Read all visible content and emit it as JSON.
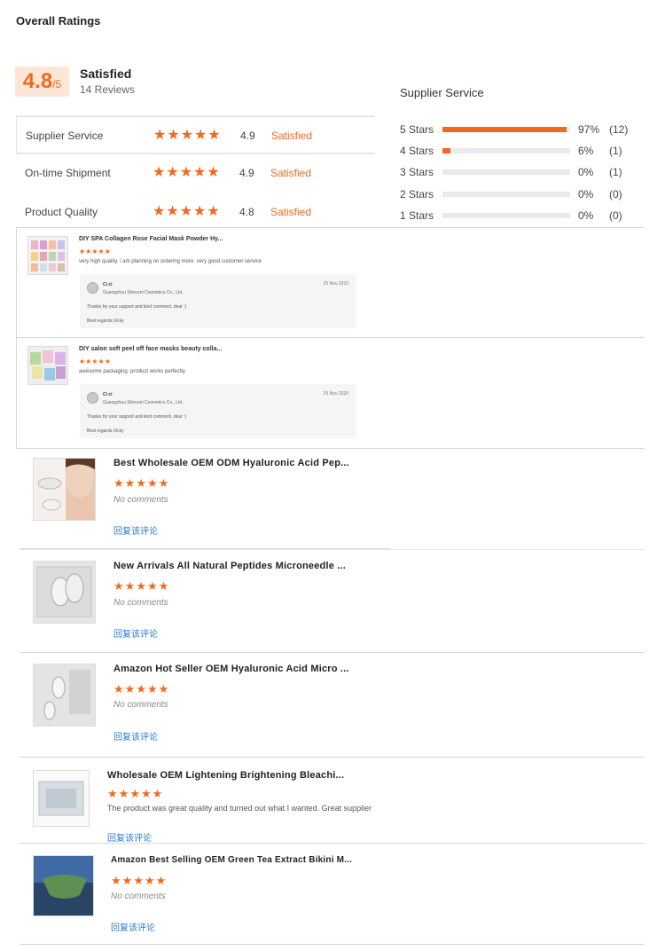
{
  "header": {
    "title": "Overall Ratings"
  },
  "summary": {
    "score": "4.8",
    "out_of": "/5",
    "label": "Satisfied",
    "reviews": "14 Reviews"
  },
  "categories": [
    {
      "label": "Supplier Service",
      "value": "4.9",
      "status": "Satisfied",
      "rating": 5
    },
    {
      "label": "On-time Shipment",
      "value": "4.9",
      "status": "Satisfied",
      "rating": 5
    },
    {
      "label": "Product Quality",
      "value": "4.8",
      "status": "Satisfied",
      "rating": 5
    }
  ],
  "breakdown": {
    "title": "Supplier Service",
    "rows": [
      {
        "label": "5 Stars",
        "pct": "97%",
        "count": "(12)",
        "fraction": 0.97
      },
      {
        "label": "4 Stars",
        "pct": "6%",
        "count": "(1)",
        "fraction": 0.06
      },
      {
        "label": "3 Stars",
        "pct": "0%",
        "count": "(1)",
        "fraction": 0
      },
      {
        "label": "2 Stars",
        "pct": "0%",
        "count": "(0)",
        "fraction": 0
      },
      {
        "label": "1 Stars",
        "pct": "0%",
        "count": "(0)",
        "fraction": 0
      }
    ]
  },
  "reviews": [
    {
      "title": "DIY SPA Collagen Rose Facial Mask Powder Hy...",
      "rating": 5,
      "text": "very high quality.  i am planning on ordering more.  very good customer service",
      "reply": {
        "name": "Ci ci",
        "company": "Guangzhou Shiruoni Cosmetics Co., Ltd.",
        "date": "25 Nov 2020",
        "message": "Thanks for your support and kind comment ,dear :)",
        "regards": "Best regards,Vicky"
      }
    },
    {
      "title": "DIY salon soft peel off face masks beauty colla...",
      "rating": 5,
      "text": "awesome packaging. product works perfectly.",
      "reply": {
        "name": "Ci ci",
        "company": "Guangzhou Shiruoni Cosmetics Co., Ltd.",
        "date": "25 Nov 2020",
        "message": "Thanks for your support and kind comment ,dear :)",
        "regards": "Best regards,Vicky"
      }
    },
    {
      "title": "Best Wholesale OEM ODM Hyaluronic Acid Pep...",
      "rating": 5,
      "text": "No comments",
      "link": "回复该评论"
    },
    {
      "title": "New Arrivals All Natural Peptides Microneedle ...",
      "rating": 5,
      "text": "No comments",
      "link": "回复该评论"
    },
    {
      "title": "Amazon Hot Seller OEM Hyaluronic Acid Micro ...",
      "rating": 5,
      "text": "No comments",
      "link": "回复该评论"
    },
    {
      "title": "Wholesale OEM Lightening Brightening Bleachi...",
      "rating": 5,
      "text": "The product was great quality and turned out what I wanted. Great supplier",
      "link": "回复该评论"
    },
    {
      "title": "Amazon Best Selling OEM Green Tea Extract Bikini M...",
      "rating": 5,
      "text": "No comments",
      "link": "回复该评论"
    }
  ],
  "colors": {
    "accent": "#f06a1d",
    "link": "#2a7ad2"
  },
  "icons": {
    "star": "star-icon"
  }
}
